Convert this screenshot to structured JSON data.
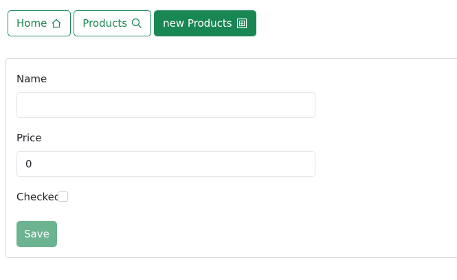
{
  "nav": {
    "home_label": "Home",
    "products_label": "Products",
    "new_products_label": "new Products",
    "accent_color": "#198754"
  },
  "form": {
    "name_label": "Name",
    "name_value": "",
    "price_label": "Price",
    "price_value": "0",
    "checked_label": "Checked",
    "checked_value": false,
    "save_label": "Save"
  },
  "icons": {
    "home": "home-icon",
    "products": "search-icon",
    "new_products": "add-box-icon"
  }
}
